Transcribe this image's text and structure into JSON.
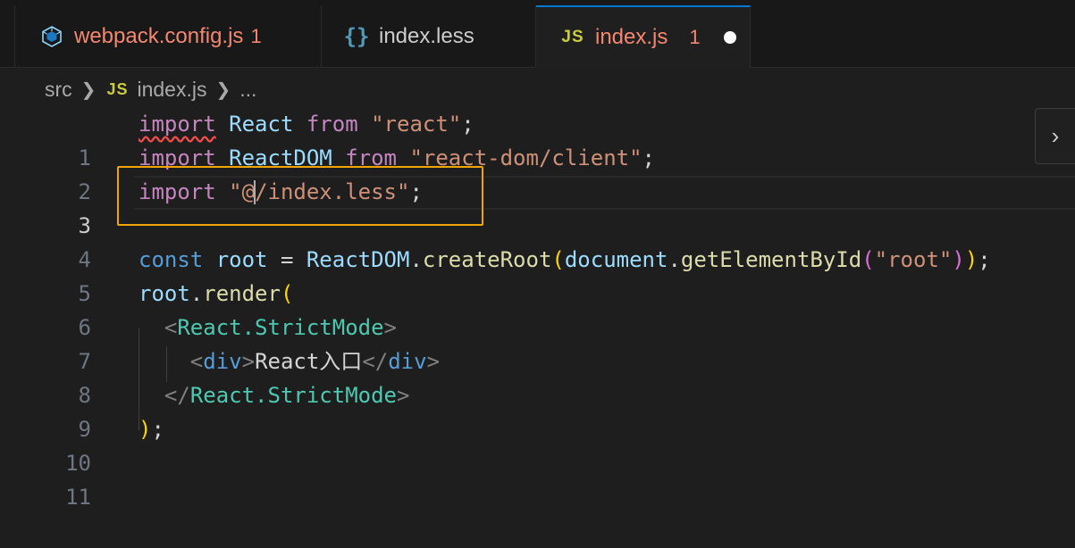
{
  "tabs": [
    {
      "icon": "webpack-icon",
      "name": "webpack.config.js",
      "badge": "1"
    },
    {
      "icon": "less-icon",
      "icon_glyph": "{}",
      "name": "index.less",
      "badge": ""
    },
    {
      "icon": "js-icon",
      "icon_glyph": "JS",
      "name": "index.js",
      "badge": "1",
      "modified": true
    }
  ],
  "breadcrumb": {
    "folder": "src",
    "file_icon_glyph": "JS",
    "file": "index.js",
    "more": "..."
  },
  "editor": {
    "line_numbers": [
      "1",
      "2",
      "3",
      "4",
      "5",
      "6",
      "7",
      "8",
      "9",
      "10",
      "11"
    ],
    "active_line": "3",
    "line1": {
      "kw": "import",
      "name": "React",
      "from": "from",
      "mod": "\"react\"",
      "end": ";"
    },
    "line2": {
      "kw": "import",
      "name": "ReactDOM",
      "from": "from",
      "mod": "\"react-dom/client\"",
      "end": ";"
    },
    "line3": {
      "kw": "import",
      "mod_open": "\"@",
      "mod_rest": "/index.less\"",
      "end": ";"
    },
    "line5": {
      "kw": "const",
      "var": "root",
      "eq": " = ",
      "obj": "ReactDOM",
      "dot": ".",
      "fn": "createRoot",
      "p1": "(",
      "arg": "document",
      "dot2": ".",
      "fn2": "getElementById",
      "p2": "(",
      "str": "\"root\"",
      "p2c": ")",
      "p1c": ")",
      "end": ";"
    },
    "line6": {
      "var": "root",
      "dot": ".",
      "fn": "render",
      "p": "("
    },
    "line7": {
      "lt": "<",
      "tag": "React.StrictMode",
      "gt": ">"
    },
    "line8": {
      "lt": "<",
      "tag": "div",
      "gt": ">",
      "text": "React入口",
      "lt2": "</",
      "tag2": "div",
      "gt2": ">"
    },
    "line9": {
      "lt": "</",
      "tag": "React.StrictMode",
      "gt": ">"
    },
    "line10": {
      "p": ")",
      "end": ";"
    }
  },
  "side_toggle": {
    "glyph": "›"
  },
  "colors": {
    "error": "#f48771",
    "highlight_box": "#f0a500",
    "active_tab_border": "#0078d4"
  }
}
